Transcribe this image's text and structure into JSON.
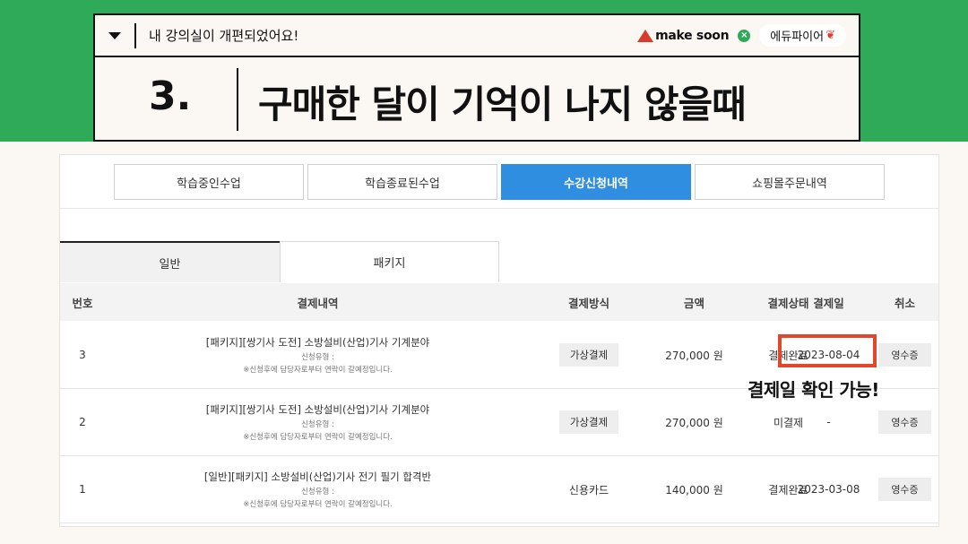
{
  "header": {
    "notice_text": "내 강의실이 개편되었어요!",
    "brand_makesoon": "make soon",
    "brand_x": "×",
    "brand_edufire": "에듀파이어",
    "title_number": "3.",
    "title_text": "구매한 달이 기억이 나지 않을때"
  },
  "top_tabs": [
    {
      "label": "학습중인수업",
      "active": false
    },
    {
      "label": "학습종료된수업",
      "active": false
    },
    {
      "label": "수강신청내역",
      "active": true
    },
    {
      "label": "쇼핑몰주문내역",
      "active": false
    }
  ],
  "sub_tabs": [
    {
      "label": "일반",
      "active": true
    },
    {
      "label": "패키지",
      "active": false
    }
  ],
  "table": {
    "columns": [
      "번호",
      "결제내역",
      "결제방식",
      "금액",
      "결제상태",
      "결제일",
      "취소"
    ],
    "rows": [
      {
        "no": "3",
        "title": "[패키지][쌍기사 도전] 소방설비(산업)기사 기계분야",
        "reg_type": "신청유형 :",
        "note": "※신청후에 담당자로부터 연락이 갈예정입니다.",
        "method": "가상결제",
        "amount": "270,000 원",
        "status": "결제완료",
        "date": "2023-08-04",
        "cancel": "영수증"
      },
      {
        "no": "2",
        "title": "[패키지][쌍기사 도전] 소방설비(산업)기사 기계분야",
        "reg_type": "신청유형 :",
        "note": "※신청후에 담당자로부터 연락이 갈예정입니다.",
        "method": "가상결제",
        "amount": "270,000 원",
        "status": "미결제",
        "date": "-",
        "cancel": "영수증"
      },
      {
        "no": "1",
        "title": "[일반][패키지] 소방설비(산업)기사 전기 필기 합격반",
        "reg_type": "신청유형 :",
        "note": "※신청후에 담당자로부터 연락이 갈예정입니다.",
        "method": "신용카드",
        "amount": "140,000 원",
        "status": "결제완료",
        "date": "2023-03-08",
        "cancel": "영수증"
      }
    ]
  },
  "callout": "결제일 확인 가능!",
  "colors": {
    "green_band": "#2eaa58",
    "active_tab": "#2f8ee0",
    "highlight": "#e2462b"
  }
}
